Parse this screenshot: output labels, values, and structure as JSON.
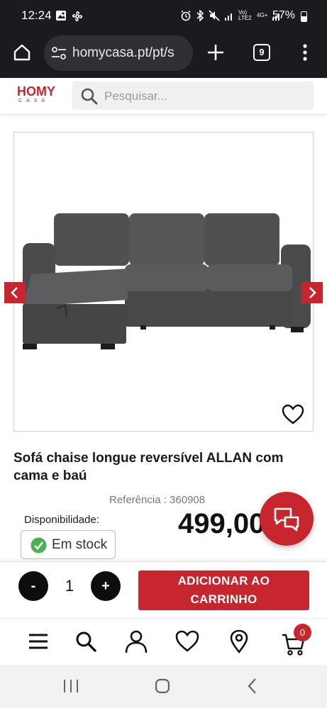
{
  "status_bar": {
    "time": "12:24",
    "battery": "57%",
    "network": "Vo) LTE2",
    "network2": "4G+"
  },
  "browser": {
    "url": "homycasa.pt/pt/s",
    "tab_count": "9"
  },
  "site": {
    "logo_main": "HOMY",
    "logo_sub": "CASA",
    "search_placeholder": "Pesquisar..."
  },
  "product": {
    "title": "Sofá chaise longue reversível ALLAN com cama e baú",
    "reference": "Referência : 360908",
    "availability_label": "Disponibilidade:",
    "stock_status": "Em stock",
    "price": "499,00 €"
  },
  "cart": {
    "minus_label": "-",
    "quantity": "1",
    "plus_label": "+",
    "add_label_line1": "ADICIONAR AO",
    "add_label_line2": "CARRINHO",
    "cart_count": "0"
  },
  "colors": {
    "brand_red": "#c8262e",
    "dark": "#1a1b1f",
    "success_green": "#4caf50"
  },
  "icons": {
    "bottom_nav": [
      "menu-icon",
      "search-icon",
      "user-icon",
      "heart-icon",
      "location-pin-icon",
      "cart-icon"
    ],
    "system_nav": [
      "recent-apps-icon",
      "home-icon",
      "back-icon"
    ]
  }
}
